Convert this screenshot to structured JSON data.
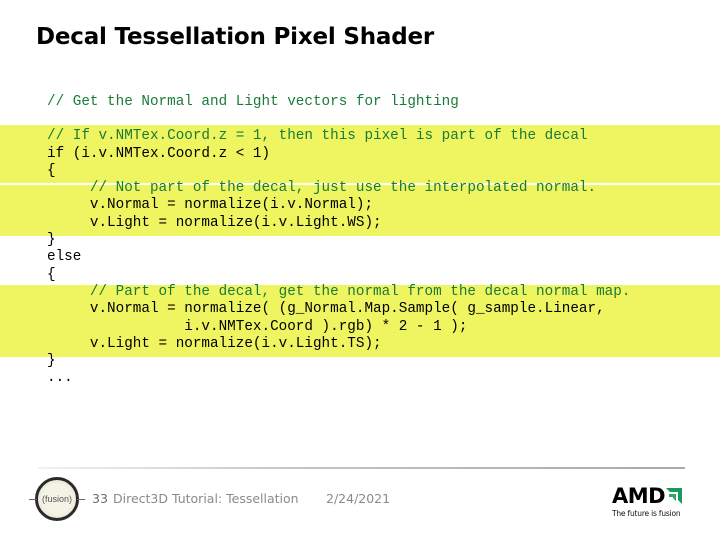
{
  "slide": {
    "title": "Decal Tessellation Pixel Shader",
    "code_lines": [
      {
        "text": "// Get the Normal and Light vectors for lighting",
        "type": "comment"
      },
      {
        "text": "",
        "type": "gap"
      },
      {
        "text": "// If v.NMTex.Coord.z = 1, then this pixel is part of the decal",
        "type": "comment"
      },
      {
        "text": "if (i.v.NMTex.Coord.z < 1)",
        "type": "code"
      },
      {
        "text": "{",
        "type": "code"
      },
      {
        "text": "     // Not part of the decal, just use the interpolated normal.",
        "type": "comment"
      },
      {
        "text": "     v.Normal = normalize(i.v.Normal);",
        "type": "code"
      },
      {
        "text": "     v.Light = normalize(i.v.Light.WS);",
        "type": "code"
      },
      {
        "text": "}",
        "type": "code"
      },
      {
        "text": "else",
        "type": "code"
      },
      {
        "text": "{",
        "type": "code"
      },
      {
        "text": "     // Part of the decal, get the normal from the decal normal map.",
        "type": "comment"
      },
      {
        "text": "     v.Normal = normalize( (g_Normal.Map.Sample( g_sample.Linear,",
        "type": "code"
      },
      {
        "text": "                i.v.NMTex.Coord ).rgb) * 2 - 1 );",
        "type": "code"
      },
      {
        "text": "     v.Light = normalize(i.v.Light.TS);",
        "type": "code"
      },
      {
        "text": "}",
        "type": "code"
      },
      {
        "text": "...",
        "type": "code"
      }
    ],
    "highlight_color": "#eef560",
    "comment_color": "#1a7a3a"
  },
  "footer": {
    "logo_text": "(fusion)",
    "slide_number": "33",
    "title": "Direct3D Tutorial: Tessellation",
    "date": "2/24/2021",
    "brand": "AMD",
    "tagline": "The future is fusion",
    "brand_accent": "#1a9a5a"
  }
}
